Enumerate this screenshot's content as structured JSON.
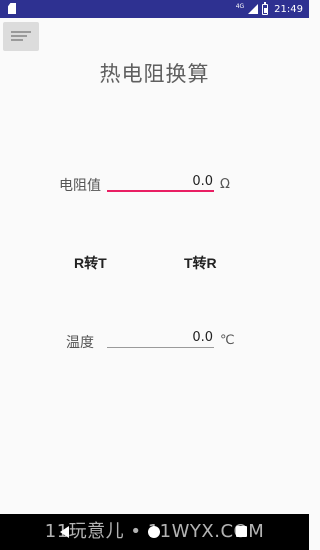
{
  "status_bar": {
    "network": "4G",
    "time": "21:49"
  },
  "app": {
    "title": "热电阻换算"
  },
  "resistance": {
    "label": "电阻值",
    "value": "0.0",
    "unit": "Ω"
  },
  "buttons": {
    "r_to_t": "R转T",
    "t_to_r": "T转R"
  },
  "temperature": {
    "label": "温度",
    "value": "0.0",
    "unit": "℃"
  },
  "watermark": "11玩意儿 • 11WYX.COM",
  "colors": {
    "status_bar": "#2e3191",
    "accent": "#e91e63",
    "background": "#fafafa"
  }
}
